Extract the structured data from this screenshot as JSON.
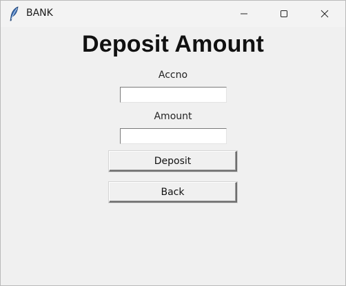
{
  "window": {
    "title": "BANK",
    "icon": "feather-icon",
    "controls": {
      "minimize_icon": "minimize-icon",
      "maximize_icon": "maximize-icon",
      "close_icon": "close-icon"
    }
  },
  "form": {
    "heading": "Deposit Amount",
    "accno_label": "Accno",
    "accno_value": "",
    "amount_label": "Amount",
    "amount_value": "",
    "deposit_label": "Deposit",
    "back_label": "Back"
  }
}
